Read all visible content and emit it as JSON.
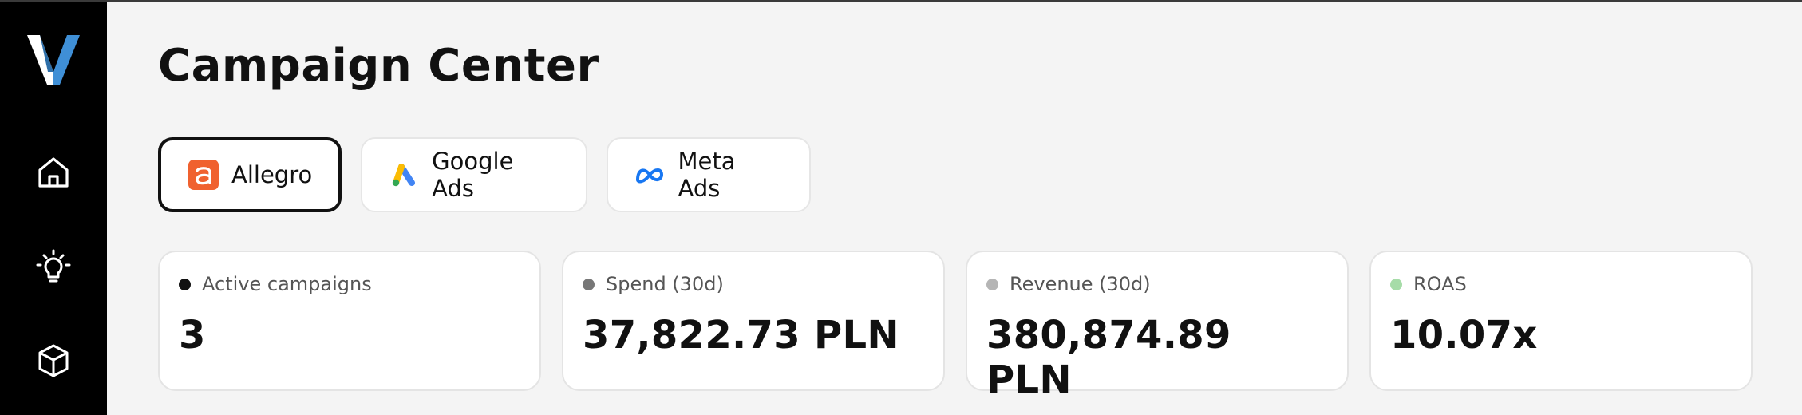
{
  "sidebar": {
    "logo_icon": "brand-v-logo",
    "items": [
      {
        "name": "home",
        "icon": "home-icon"
      },
      {
        "name": "ideas",
        "icon": "lightbulb-icon"
      },
      {
        "name": "products",
        "icon": "cube-icon"
      }
    ]
  },
  "header": {
    "title": "Campaign Center"
  },
  "tabs": [
    {
      "label": "Allegro",
      "icon": "allegro-icon",
      "active": true
    },
    {
      "label": "Google Ads",
      "icon": "google-ads-icon",
      "active": false
    },
    {
      "label": "Meta Ads",
      "icon": "meta-icon",
      "active": false
    }
  ],
  "stats": [
    {
      "label": "Active campaigns",
      "value": "3",
      "dot_color": "#111111"
    },
    {
      "label": "Spend (30d)",
      "value": "37,822.73 PLN",
      "dot_color": "#777777"
    },
    {
      "label": "Revenue (30d)",
      "value": "380,874.89 PLN",
      "dot_color": "#b5b5b5"
    },
    {
      "label": "ROAS",
      "value": "10.07x",
      "dot_color": "#a6dca8"
    }
  ],
  "colors": {
    "sidebar_bg": "#000000",
    "logo_blue": "#3f8fd6",
    "allegro_orange": "#f0612f",
    "meta_blue": "#1877f2"
  }
}
